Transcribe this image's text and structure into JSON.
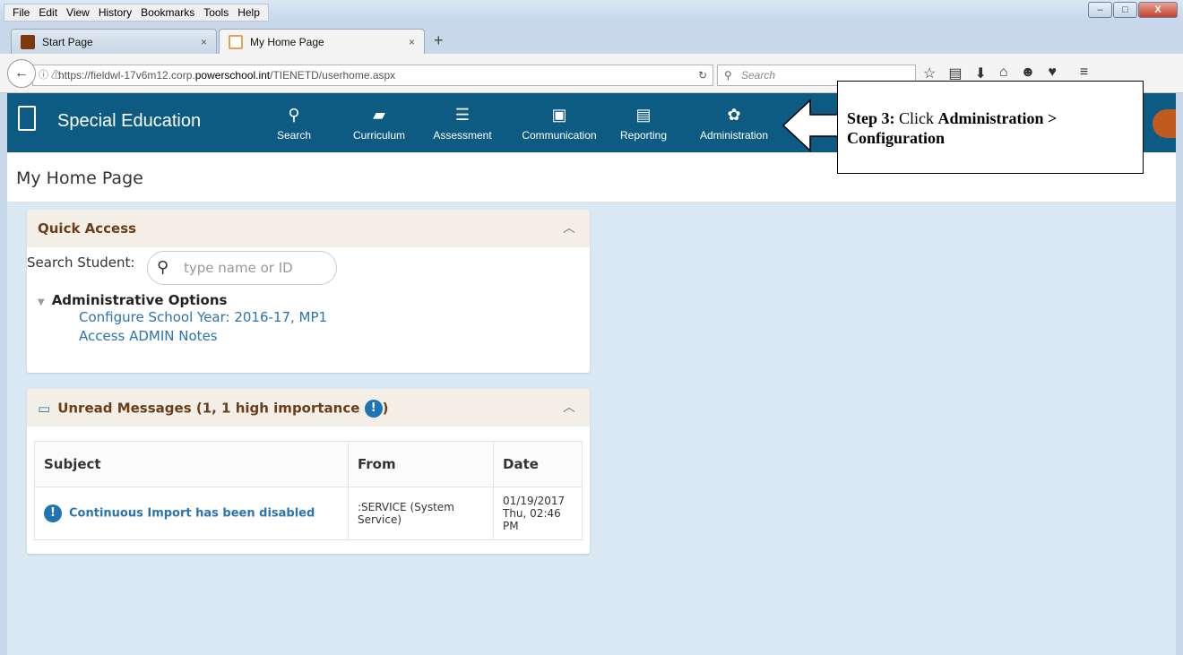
{
  "browser": {
    "menu": [
      "File",
      "Edit",
      "View",
      "History",
      "Bookmarks",
      "Tools",
      "Help"
    ],
    "tabs": [
      {
        "label": "Start Page",
        "close": "×"
      },
      {
        "label": "My Home Page",
        "close": "×"
      }
    ],
    "new_tab": "+",
    "url_prefix": "https://fieldwl-17v6m12.corp.",
    "url_domain": "powerschool.int",
    "url_suffix": "/TIENETD/userhome.aspx",
    "search_placeholder": "Search"
  },
  "app": {
    "title": "Special Education",
    "nav": [
      {
        "label": "Search",
        "icon": "search-icon"
      },
      {
        "label": "Curriculum",
        "icon": "book-icon"
      },
      {
        "label": "Assessment",
        "icon": "clipboard-icon"
      },
      {
        "label": "Communication",
        "icon": "communication-icon"
      },
      {
        "label": "Reporting",
        "icon": "document-icon"
      },
      {
        "label": "Administration",
        "icon": "gear-icon"
      }
    ],
    "header_color": "#0d5b82"
  },
  "page": {
    "title": "My Home Page"
  },
  "quick_access": {
    "title": "Quick Access",
    "search_label": "Search Student:",
    "search_placeholder": "type name or ID",
    "admin_header": "Administrative Options",
    "links": [
      "Configure School Year: 2016-17, MP1",
      "Access ADMIN Notes"
    ]
  },
  "messages": {
    "title": "Unread Messages (1, 1 high importance",
    "title_close": ")",
    "columns": [
      "Subject",
      "From",
      "Date"
    ],
    "rows": [
      {
        "subject": "Continuous Import has been disabled",
        "from": ":SERVICE (System Service)",
        "date": "01/19/2017",
        "time": "Thu, 02:46 PM"
      }
    ]
  },
  "callout": {
    "step": "Step 3:",
    "text1": " Click ",
    "bold1": "Administration",
    "sep": " >",
    "bold2": "Configuration"
  }
}
